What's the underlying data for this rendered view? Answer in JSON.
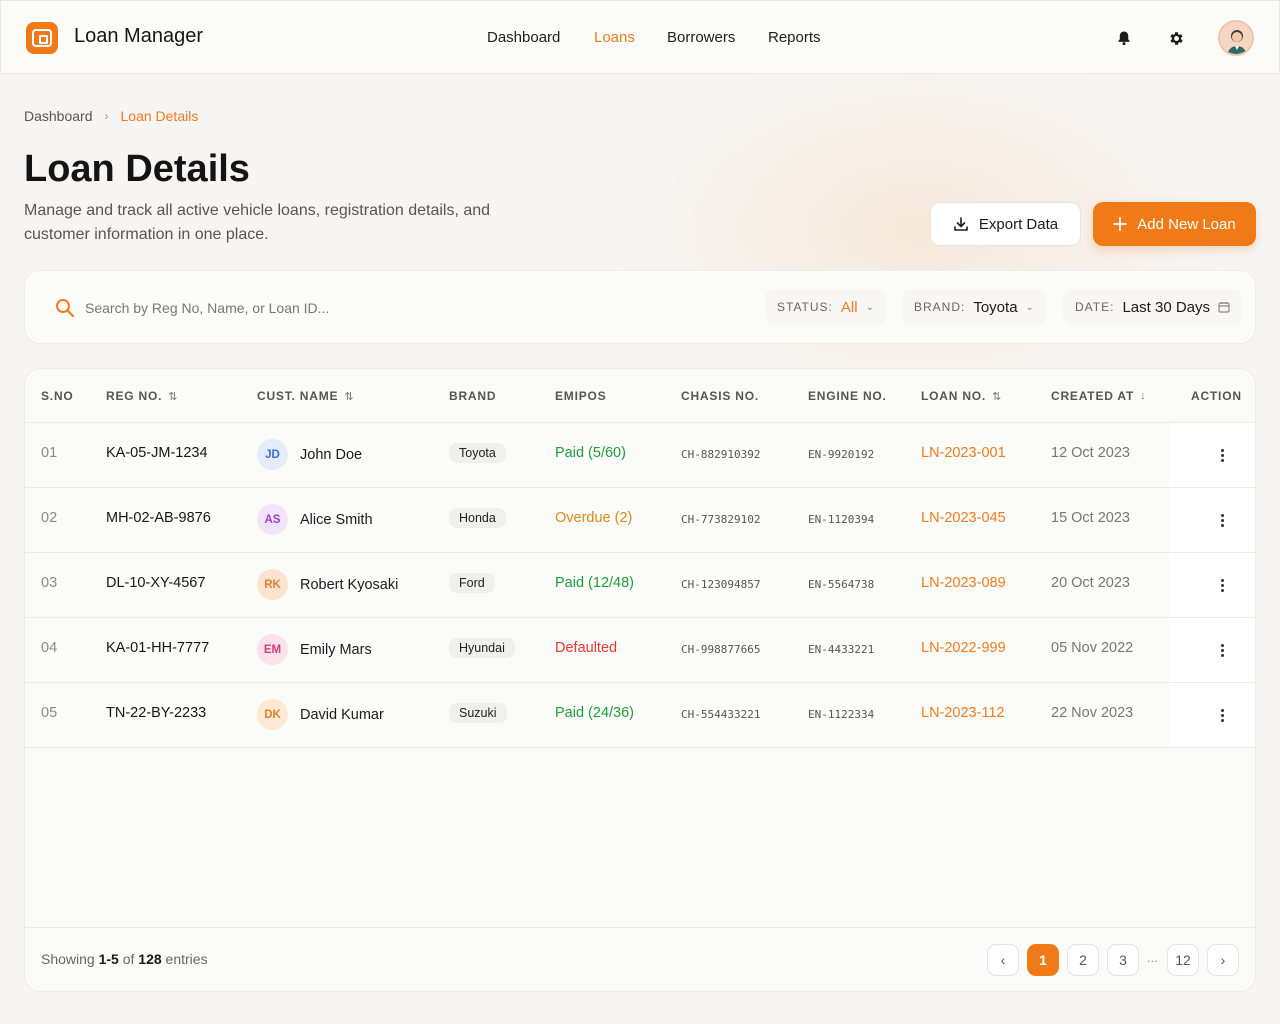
{
  "app": {
    "name": "Loan Manager"
  },
  "nav": {
    "items": [
      {
        "label": "Dashboard",
        "active": false
      },
      {
        "label": "Loans",
        "active": true
      },
      {
        "label": "Borrowers",
        "active": false
      },
      {
        "label": "Reports",
        "active": false
      }
    ]
  },
  "header_icons": [
    "bell-icon",
    "gear-icon",
    "user-avatar"
  ],
  "breadcrumb": {
    "items": [
      "Dashboard",
      "Loan Details"
    ]
  },
  "page": {
    "title": "Loan Details",
    "subtitle": "Manage and track all active vehicle loans, registration details, and customer information in one place."
  },
  "actions": {
    "export_label": "Export Data",
    "add_label": "Add New Loan"
  },
  "filters": {
    "search_placeholder": "Search by Reg No, Name, or Loan ID...",
    "status": {
      "label": "STATUS:",
      "value": "All"
    },
    "brand": {
      "label": "BRAND:",
      "value": "Toyota"
    },
    "date": {
      "label": "DATE:",
      "value": "Last 30 Days"
    }
  },
  "table": {
    "columns": [
      "S.NO",
      "REG NO.",
      "CUST. NAME",
      "BRAND",
      "EMIPOS",
      "CHASIS NO.",
      "ENGINE NO.",
      "LOAN NO.",
      "CREATED AT",
      "ACTION"
    ],
    "rows": [
      {
        "sno": "01",
        "reg": "KA-05-JM-1234",
        "initials": "JD",
        "name": "John Doe",
        "brand": "Toyota",
        "emi": "Paid (5/60)",
        "emi_status": "paid",
        "chassis": "CH-882910392",
        "engine": "EN-9920192",
        "loan": "LN-2023-001",
        "created": "12 Oct 2023"
      },
      {
        "sno": "02",
        "reg": "MH-02-AB-9876",
        "initials": "AS",
        "name": "Alice Smith",
        "brand": "Honda",
        "emi": "Overdue (2)",
        "emi_status": "overdue",
        "chassis": "CH-773829102",
        "engine": "EN-1120394",
        "loan": "LN-2023-045",
        "created": "15 Oct 2023"
      },
      {
        "sno": "03",
        "reg": "DL-10-XY-4567",
        "initials": "RK",
        "name": "Robert Kyosaki",
        "brand": "Ford",
        "emi": "Paid (12/48)",
        "emi_status": "paid",
        "chassis": "CH-123094857",
        "engine": "EN-5564738",
        "loan": "LN-2023-089",
        "created": "20 Oct 2023"
      },
      {
        "sno": "04",
        "reg": "KA-01-HH-7777",
        "initials": "EM",
        "name": "Emily Mars",
        "brand": "Hyundai",
        "emi": "Defaulted",
        "emi_status": "defaulted",
        "chassis": "CH-998877665",
        "engine": "EN-4433221",
        "loan": "LN-2022-999",
        "created": "05 Nov 2022"
      },
      {
        "sno": "05",
        "reg": "TN-22-BY-2233",
        "initials": "DK",
        "name": "David Kumar",
        "brand": "Suzuki",
        "emi": "Paid (24/36)",
        "emi_status": "paid",
        "chassis": "CH-554433221",
        "engine": "EN-1122334",
        "loan": "LN-2023-112",
        "created": "22 Nov 2023"
      }
    ]
  },
  "pagination": {
    "showing_prefix": "Showing",
    "range": "1-5",
    "of": "of",
    "total": "128",
    "suffix": "entries",
    "pages": [
      "1",
      "2",
      "3",
      "12"
    ],
    "ellipsis": "...",
    "current": "1"
  },
  "colors": {
    "accent": "#ef7a17",
    "paid": "#1f9c3a",
    "overdue": "#d98a18",
    "defaulted": "#e03a2e"
  }
}
